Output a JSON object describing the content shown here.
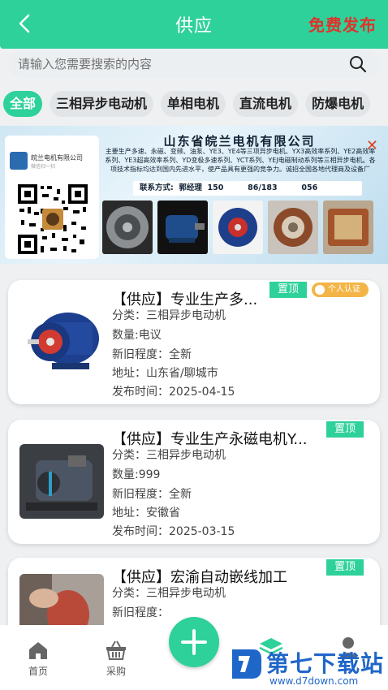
{
  "header": {
    "title": "供应",
    "publish_label": "免费发布"
  },
  "search": {
    "placeholder": "请输入您需要搜索的内容"
  },
  "categories": [
    {
      "label": "全部",
      "active": true
    },
    {
      "label": "三相异步电动机",
      "active": false
    },
    {
      "label": "单相电机",
      "active": false
    },
    {
      "label": "直流电机",
      "active": false
    },
    {
      "label": "防爆电机",
      "active": false
    }
  ],
  "banner": {
    "company": "山东省皖兰电机有限公司",
    "description": "主要生产多速、永磁、变频、油泵、YE3、YE4等三项异步电机、YX3高效率系列、YE2高效率系列、YE3超高效率系列、YD变极多速系列、YCT系列、YEJ电磁制动系列等三相异步电机。各项技术指标均达到国内先进水平，使产品具有更强的竞争力。诚招全国各地代理商及设备厂",
    "contact": "联系方式:  郭经理  150         86/183         056",
    "qr_name": "皖兰电机有限公司",
    "qr_sub": "微信扫一扫",
    "close_icon": "close-icon"
  },
  "listings": [
    {
      "title": "【供应】专业生产多...",
      "pin_label": "置顶",
      "verify_label": "个人认证",
      "category": "分类：三相异步电动机",
      "quantity": "数量:电议",
      "condition": "新旧程度：全新",
      "address": "地址：山东省/聊城市",
      "date": "发布时间：2025-04-15"
    },
    {
      "title": "【供应】专业生产永磁电机Y...",
      "pin_label": "置顶",
      "category": "分类：三相异步电动机",
      "quantity": "数量:999",
      "condition": "新旧程度：全新",
      "address": "地址：安徽省",
      "date": "发布时间：2025-03-15"
    },
    {
      "title": "【供应】宏渝自动嵌线加工",
      "pin_label": "置顶",
      "category": "分类：三相异步电动机",
      "condition": "新旧程度："
    }
  ],
  "bottom_nav": {
    "home_label": "首页",
    "purchase_label": "采购"
  },
  "watermark": {
    "text": "第七下载站",
    "url": "www.d7down.com"
  },
  "colors": {
    "accent": "#2ed19a",
    "publish": "#e0322b",
    "verify": "#f4b547"
  }
}
